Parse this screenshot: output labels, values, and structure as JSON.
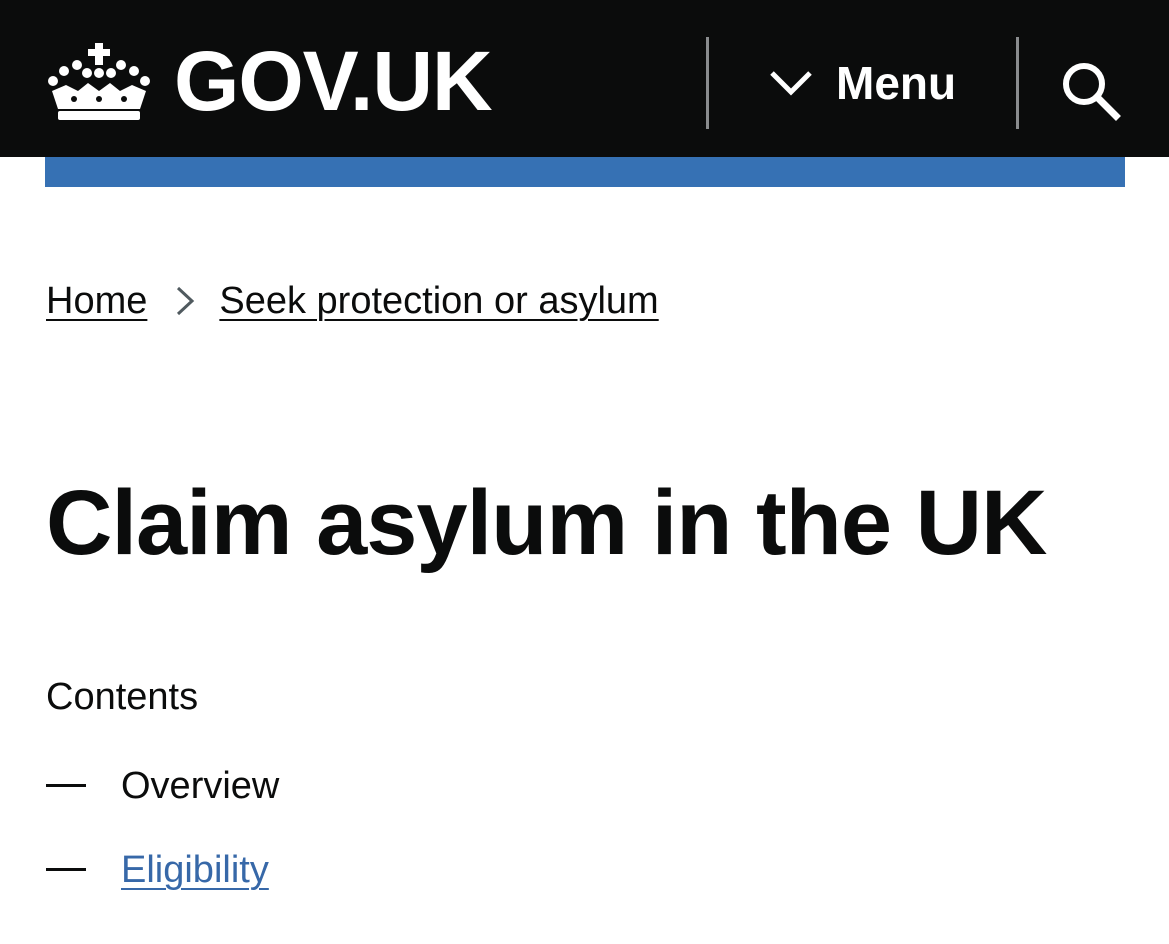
{
  "header": {
    "logo_text": "GOV.UK",
    "logo_icon": "crown-icon",
    "menu_label": "Menu",
    "menu_icon": "chevron-down-icon",
    "search_icon": "search-icon",
    "colors": {
      "background": "#0b0c0c",
      "text": "#ffffff",
      "accent_bar": "#3671b4"
    }
  },
  "breadcrumb": {
    "items": [
      {
        "label": "Home"
      },
      {
        "label": "Seek protection or asylum"
      }
    ],
    "separator_icon": "chevron-right-icon"
  },
  "page": {
    "title": "Claim asylum in the UK"
  },
  "contents": {
    "heading": "Contents",
    "items": [
      {
        "label": "Overview",
        "current": true
      },
      {
        "label": "Eligibility",
        "current": false
      }
    ],
    "link_color": "#3768a8"
  }
}
